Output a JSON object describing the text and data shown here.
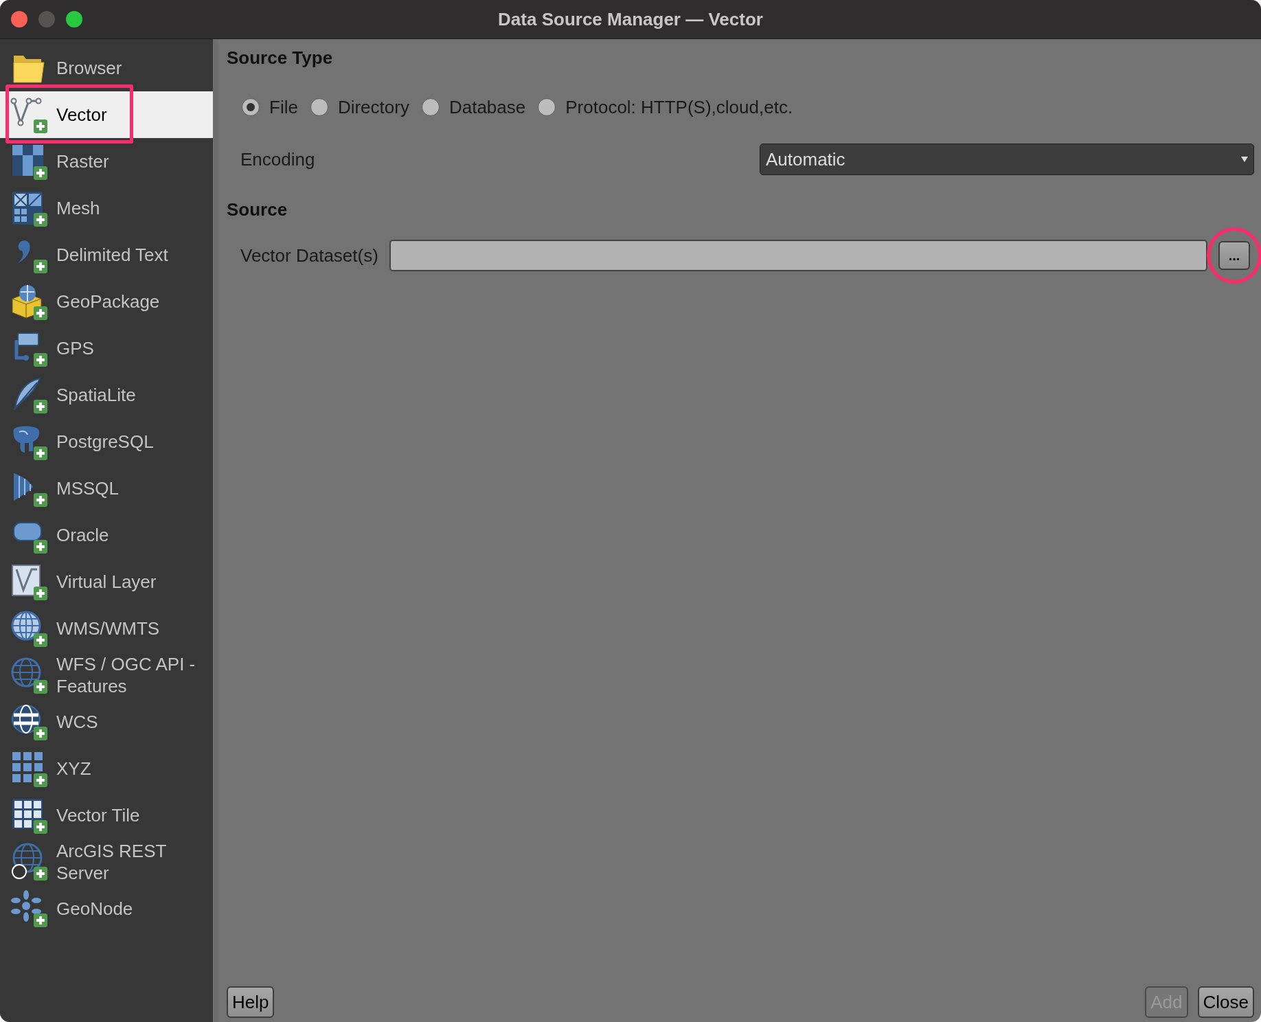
{
  "window": {
    "title": "Data Source Manager — Vector"
  },
  "sidebar": {
    "items": [
      {
        "label": "Browser",
        "selected": false,
        "highlighted": false
      },
      {
        "label": "Vector",
        "selected": true,
        "highlighted": true
      },
      {
        "label": "Raster",
        "selected": false,
        "highlighted": false
      },
      {
        "label": "Mesh",
        "selected": false,
        "highlighted": false
      },
      {
        "label": "Delimited Text",
        "selected": false,
        "highlighted": false
      },
      {
        "label": "GeoPackage",
        "selected": false,
        "highlighted": false
      },
      {
        "label": "GPS",
        "selected": false,
        "highlighted": false
      },
      {
        "label": "SpatiaLite",
        "selected": false,
        "highlighted": false
      },
      {
        "label": "PostgreSQL",
        "selected": false,
        "highlighted": false
      },
      {
        "label": "MSSQL",
        "selected": false,
        "highlighted": false
      },
      {
        "label": "Oracle",
        "selected": false,
        "highlighted": false
      },
      {
        "label": "Virtual Layer",
        "selected": false,
        "highlighted": false
      },
      {
        "label": "WMS/WMTS",
        "selected": false,
        "highlighted": false
      },
      {
        "label": "WFS / OGC API - Features",
        "selected": false,
        "highlighted": false
      },
      {
        "label": "WCS",
        "selected": false,
        "highlighted": false
      },
      {
        "label": "XYZ",
        "selected": false,
        "highlighted": false
      },
      {
        "label": "Vector Tile",
        "selected": false,
        "highlighted": false
      },
      {
        "label": "ArcGIS REST Server",
        "selected": false,
        "highlighted": false
      },
      {
        "label": "GeoNode",
        "selected": false,
        "highlighted": false
      }
    ]
  },
  "source_type": {
    "heading": "Source Type",
    "options": [
      {
        "label": "File",
        "selected": true
      },
      {
        "label": "Directory",
        "selected": false
      },
      {
        "label": "Database",
        "selected": false
      },
      {
        "label": "Protocol: HTTP(S),cloud,etc.",
        "selected": false
      }
    ]
  },
  "encoding": {
    "label": "Encoding",
    "value": "Automatic"
  },
  "source": {
    "heading": "Source",
    "label": "Vector Dataset(s)",
    "browse_button": {
      "label": "...",
      "highlighted": true
    }
  },
  "footer": {
    "left_buttons": [
      {
        "label": "Help",
        "disabled": false
      }
    ],
    "right_buttons": [
      {
        "label": "Add",
        "disabled": true
      },
      {
        "label": "Close",
        "disabled": false
      }
    ]
  }
}
